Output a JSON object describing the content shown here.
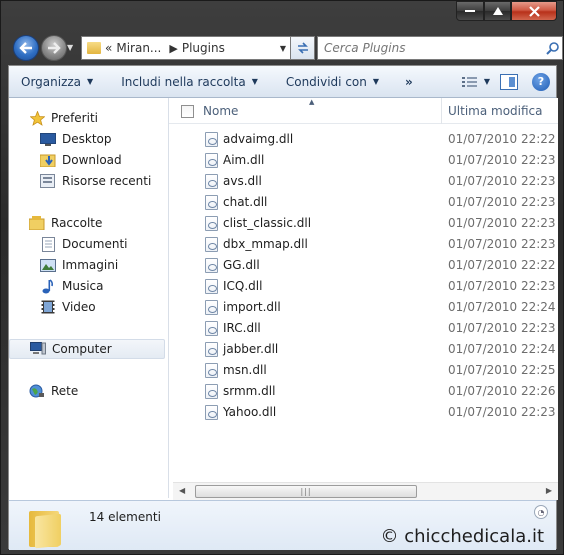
{
  "address": {
    "overflow": "«",
    "segments": [
      "Miran...",
      "Plugins"
    ]
  },
  "search": {
    "placeholder": "Cerca Plugins"
  },
  "toolbar": {
    "organize": "Organizza",
    "include": "Includi nella raccolta",
    "share": "Condividi con",
    "more": "»"
  },
  "nav": {
    "favorites": "Preferiti",
    "desktop": "Desktop",
    "download": "Download",
    "recent": "Risorse recenti",
    "libraries": "Raccolte",
    "documents": "Documenti",
    "images": "Immagini",
    "music": "Musica",
    "video": "Video",
    "computer": "Computer",
    "network": "Rete"
  },
  "columns": {
    "name": "Nome",
    "modified": "Ultima modifica"
  },
  "files": [
    {
      "name": "advaimg.dll",
      "date": "01/07/2010 22:22"
    },
    {
      "name": "Aim.dll",
      "date": "01/07/2010 22:23"
    },
    {
      "name": "avs.dll",
      "date": "01/07/2010 22:23"
    },
    {
      "name": "chat.dll",
      "date": "01/07/2010 22:23"
    },
    {
      "name": "clist_classic.dll",
      "date": "01/07/2010 22:23"
    },
    {
      "name": "dbx_mmap.dll",
      "date": "01/07/2010 22:23"
    },
    {
      "name": "GG.dll",
      "date": "01/07/2010 22:22"
    },
    {
      "name": "ICQ.dll",
      "date": "01/07/2010 22:23"
    },
    {
      "name": "import.dll",
      "date": "01/07/2010 22:24"
    },
    {
      "name": "IRC.dll",
      "date": "01/07/2010 22:23"
    },
    {
      "name": "jabber.dll",
      "date": "01/07/2010 22:24"
    },
    {
      "name": "msn.dll",
      "date": "01/07/2010 22:25"
    },
    {
      "name": "srmm.dll",
      "date": "01/07/2010 22:26"
    },
    {
      "name": "Yahoo.dll",
      "date": "01/07/2010 22:23"
    }
  ],
  "details": {
    "count": "14 elementi"
  },
  "watermark": "© chicchedicala.it"
}
